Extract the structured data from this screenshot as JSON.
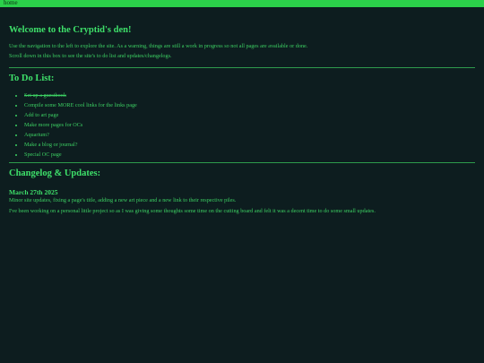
{
  "nav": {
    "home_label": "home"
  },
  "main": {
    "title": "Welcome to the Cryptid's den!",
    "intro_lines": [
      "Use the navigation to the left to explore the site. As a warning, things are still a work in progress so not all pages are available or done.",
      "Scroll down in this box to see the site's to do list and updates/changelogs."
    ]
  },
  "todo": {
    "heading": "To Do List:",
    "items": [
      {
        "label": "Set up a guestbook",
        "done": true
      },
      {
        "label": "Compile some MORE cool links for the links page",
        "done": false
      },
      {
        "label": "Add to art page",
        "done": false
      },
      {
        "label": "Make more pages for OCs",
        "done": false
      },
      {
        "label": "Aquarium?",
        "done": false
      },
      {
        "label": "Make a blog or journal?",
        "done": false
      },
      {
        "label": "Special OC page",
        "done": false
      }
    ]
  },
  "changelog": {
    "heading": "Changelog & Updates:",
    "entries": [
      {
        "date": "March 27th 2025",
        "lines": [
          "Minor site updates, fixing a page's title, adding a new art piece and a new link to their respective piles.",
          "I've been working on a personal little project so as I was giving some thoughts some time on the cutting board and felt it was a decent time to do some small updates."
        ]
      }
    ]
  },
  "colors": {
    "accent": "#2bd04a",
    "text": "#3ee06a",
    "background": "#0d1d1f"
  }
}
